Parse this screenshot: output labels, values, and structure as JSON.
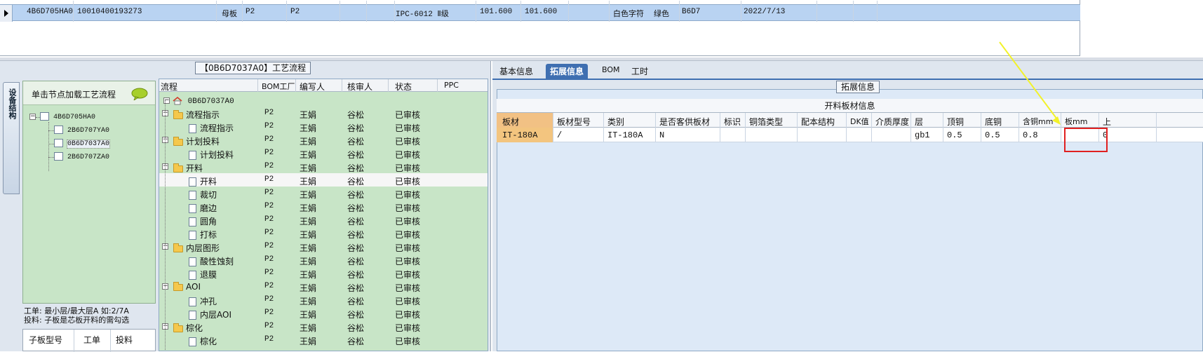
{
  "top_grid": {
    "row": [
      "4B6D705HA0",
      "10010400193273",
      "母板",
      "P2",
      "P2",
      "IPC-6012 Ⅱ级",
      "101.600",
      "101.600",
      "白色字符",
      "绿色",
      "B6D7",
      "2022/7/13"
    ]
  },
  "left_panel": {
    "title": "【0B6D7037A0】工艺流程",
    "side_tab": "设备结构",
    "tree_header": "单击节点加载工艺流程",
    "tree": [
      "4B6D705HA0",
      "2B6D707YA0",
      "0B6D7037A0",
      "2B6D707ZA0"
    ],
    "note_line1": "工单: 最小层/最大层A  如:2/7A",
    "note_line2": "投料: 子板是芯板开料的需勾选",
    "bottom_tabs": [
      "子板型号",
      "工单",
      "投料"
    ]
  },
  "process_grid": {
    "columns": [
      "流程",
      "BOM工厂",
      "编写人",
      "核审人",
      "状态",
      "PPC"
    ],
    "root": "0B6D7037A0",
    "rows": [
      {
        "label": "流程指示",
        "level": 1,
        "folder": true,
        "bom": "P2",
        "writer": "王娟",
        "reviewer": "谷松",
        "status": "已审核"
      },
      {
        "label": "流程指示",
        "level": 2,
        "folder": false,
        "bom": "P2",
        "writer": "王娟",
        "reviewer": "谷松",
        "status": "已审核"
      },
      {
        "label": "计划投料",
        "level": 1,
        "folder": true,
        "bom": "P2",
        "writer": "王娟",
        "reviewer": "谷松",
        "status": "已审核"
      },
      {
        "label": "计划投料",
        "level": 2,
        "folder": false,
        "bom": "P2",
        "writer": "王娟",
        "reviewer": "谷松",
        "status": "已审核"
      },
      {
        "label": "开料",
        "level": 1,
        "folder": true,
        "bom": "P2",
        "writer": "王娟",
        "reviewer": "谷松",
        "status": "已审核"
      },
      {
        "label": "开料",
        "level": 2,
        "folder": false,
        "bom": "P2",
        "writer": "王娟",
        "reviewer": "谷松",
        "status": "已审核",
        "highlight": true
      },
      {
        "label": "裁切",
        "level": 2,
        "folder": false,
        "bom": "P2",
        "writer": "王娟",
        "reviewer": "谷松",
        "status": "已审核"
      },
      {
        "label": "磨边",
        "level": 2,
        "folder": false,
        "bom": "P2",
        "writer": "王娟",
        "reviewer": "谷松",
        "status": "已审核"
      },
      {
        "label": "圆角",
        "level": 2,
        "folder": false,
        "bom": "P2",
        "writer": "王娟",
        "reviewer": "谷松",
        "status": "已审核"
      },
      {
        "label": "打标",
        "level": 2,
        "folder": false,
        "bom": "P2",
        "writer": "王娟",
        "reviewer": "谷松",
        "status": "已审核"
      },
      {
        "label": "内层图形",
        "level": 1,
        "folder": true,
        "bom": "P2",
        "writer": "王娟",
        "reviewer": "谷松",
        "status": "已审核"
      },
      {
        "label": "酸性蚀刻",
        "level": 2,
        "folder": false,
        "bom": "P2",
        "writer": "王娟",
        "reviewer": "谷松",
        "status": "已审核"
      },
      {
        "label": "退膜",
        "level": 2,
        "folder": false,
        "bom": "P2",
        "writer": "王娟",
        "reviewer": "谷松",
        "status": "已审核"
      },
      {
        "label": "AOI",
        "level": 1,
        "folder": true,
        "bom": "P2",
        "writer": "王娟",
        "reviewer": "谷松",
        "status": "已审核"
      },
      {
        "label": "冲孔",
        "level": 2,
        "folder": false,
        "bom": "P2",
        "writer": "王娟",
        "reviewer": "谷松",
        "status": "已审核"
      },
      {
        "label": "内层AOI",
        "level": 2,
        "folder": false,
        "bom": "P2",
        "writer": "王娟",
        "reviewer": "谷松",
        "status": "已审核"
      },
      {
        "label": "棕化",
        "level": 1,
        "folder": true,
        "bom": "P2",
        "writer": "王娟",
        "reviewer": "谷松",
        "status": "已审核"
      },
      {
        "label": "棕化",
        "level": 2,
        "folder": false,
        "bom": "P2",
        "writer": "王娟",
        "reviewer": "谷松",
        "status": "已审核"
      }
    ]
  },
  "right_panel": {
    "tabs": [
      "基本信息",
      "拓展信息",
      "BOM",
      "工时"
    ],
    "active_tab": "拓展信息",
    "group_title": "拓展信息",
    "caption": "开料板材信息",
    "columns": [
      "板材",
      "板材型号",
      "类别",
      "是否客供板材",
      "标识",
      "铜箔类型",
      "配本结构",
      "DK值",
      "介质厚度",
      "层",
      "顶铜",
      "底铜",
      "含铜mm",
      "板mm",
      "上"
    ],
    "row": [
      "IT-180A",
      "/",
      "IT-180A",
      "N",
      "",
      "",
      "",
      "",
      "",
      "gb1",
      "0.5",
      "0.5",
      "0.8",
      "",
      "0"
    ]
  },
  "annotation": {
    "color": "#e02020",
    "arrow_color": "#ffff33"
  }
}
